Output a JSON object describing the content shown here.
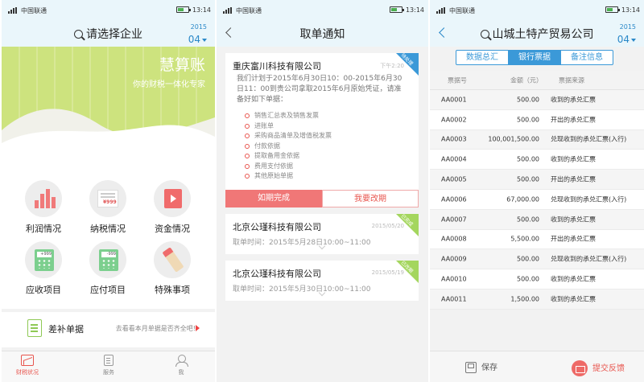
{
  "status": {
    "carrier": "中国联通",
    "time": "13:14"
  },
  "screen1": {
    "title": "请选择企业",
    "year": "2015",
    "month": "04",
    "brand_name": "慧算账",
    "brand_slogan": "你的财税一体化专家",
    "menu": [
      {
        "label": "利润情况",
        "icon": "bar-chart-icon"
      },
      {
        "label": "纳税情况",
        "icon": "invoice-icon",
        "amount": "¥999"
      },
      {
        "label": "资金情况",
        "icon": "video-icon"
      },
      {
        "label": "应收项目",
        "icon": "calculator-icon",
        "display": "+999"
      },
      {
        "label": "应付项目",
        "icon": "calculator-icon",
        "display": "-999"
      },
      {
        "label": "特殊事项",
        "icon": "pen-icon"
      }
    ],
    "supplement": {
      "title": "差补单据",
      "hint": "去看看本月单据是否齐全吧!"
    },
    "tabs": [
      "财税状况",
      "服务",
      "我"
    ],
    "active_tab": "财税状况"
  },
  "screen2": {
    "title": "取单通知",
    "cards": [
      {
        "company": "重庆富川科技有限公司",
        "time": "下午2:20",
        "badge": "待处理",
        "desc": "我们计划于2015年6月30日10：00-2015年6月30日11：00到贵公司拿取2015年6月原始凭证，请准备好如下单据：",
        "items": [
          "销售汇总表及销售发票",
          "进账单",
          "采购商品清单及增值税发票",
          "付款依据",
          "提取备用金依据",
          "费用支付依据",
          "其他原始单据"
        ],
        "btn_done": "如期完成",
        "btn_change": "我要改期"
      },
      {
        "company": "北京公瑾科技有限公司",
        "time": "2015/05/20",
        "badge": "已完成",
        "pick": "取单时间：2015年5月28日10:00~11:00"
      },
      {
        "company": "北京公瑾科技有限公司",
        "time": "2015/05/19",
        "badge": "已改期",
        "pick": "取单时间：2015年5月30日10:00~11:00"
      }
    ]
  },
  "screen3": {
    "title": "山城土特产贸易公司",
    "year": "2015",
    "month": "04",
    "segments": [
      "数据总汇",
      "银行票据",
      "备注信息"
    ],
    "active_segment": "银行票据",
    "columns": [
      "票据号",
      "金额（元）",
      "票据来源"
    ],
    "rows": [
      [
        "AA0001",
        "500.00",
        "收到的承兑汇票"
      ],
      [
        "AA0002",
        "500.00",
        "开出的承兑汇票"
      ],
      [
        "AA0003",
        "100,001,500.00",
        "兑现收到的承兑汇票(入行)"
      ],
      [
        "AA0004",
        "500.00",
        "收到的承兑汇票"
      ],
      [
        "AA0005",
        "500.00",
        "开出的承兑汇票"
      ],
      [
        "AA0006",
        "67,000.00",
        "兑现收到的承兑汇票(入行)"
      ],
      [
        "AA0007",
        "500.00",
        "收到的承兑汇票"
      ],
      [
        "AA0008",
        "5,500.00",
        "开出的承兑汇票"
      ],
      [
        "AA0009",
        "500.00",
        "兑现收到的承兑汇票(入行)"
      ],
      [
        "AA0010",
        "500.00",
        "收到的承兑汇票"
      ],
      [
        "AA0011",
        "1,500.00",
        "收到的承兑汇票"
      ]
    ],
    "save_label": "保存",
    "submit_label": "提交反馈"
  },
  "colors": {
    "accent_blue": "#3b99d8",
    "accent_red": "#e8554e",
    "banner_green": "#cde37e"
  }
}
